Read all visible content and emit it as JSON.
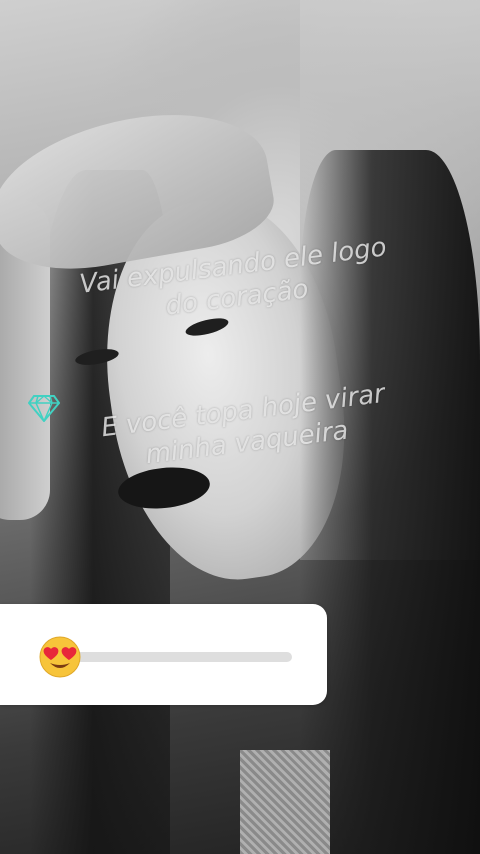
{
  "story": {
    "caption_line1_a": "Vai expulsando ele logo",
    "caption_line1_b": "do coração",
    "caption_line2_a": "E você topa hoje virar",
    "caption_line2_b": "minha vaqueira",
    "gem_icon": "diamond-icon",
    "gem_color": "#41d1c2"
  },
  "slider_sticker": {
    "emoji_icon": "heart-eyes-emoji-icon",
    "value": 0.0,
    "track_color": "#dedede",
    "fill_color": "#8a4ccf"
  }
}
